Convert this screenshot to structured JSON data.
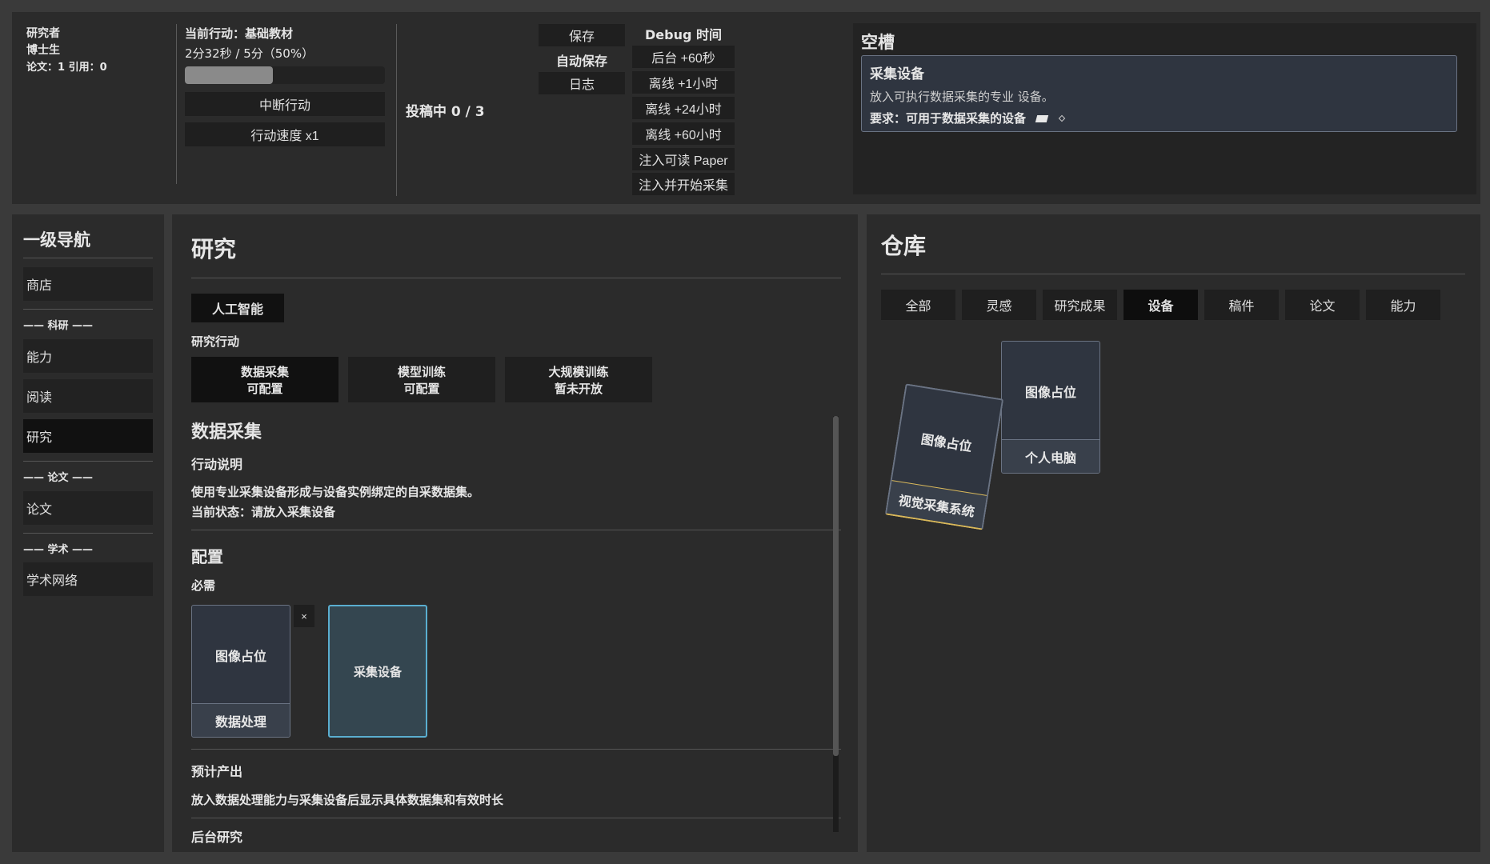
{
  "player": {
    "role": "研究者",
    "degree": "博士生",
    "stats": "论文：1  引用：0"
  },
  "action": {
    "current": "当前行动：基础教材",
    "time": "2分32秒 / 5分（50%）",
    "progress": 0.5,
    "interrupt": "中断行动",
    "speed": "行动速度 x1"
  },
  "submission": {
    "text": "投稿中 0 / 3"
  },
  "file_menu": {
    "save": "保存",
    "autosave": "自动保存",
    "log": "日志"
  },
  "debug": {
    "title": "Debug 时间",
    "buttons": [
      "后台 +60秒",
      "离线 +1小时",
      "离线 +24小时",
      "离线 +60小时",
      "注入可读 Paper",
      "注入并开始采集"
    ]
  },
  "slot": {
    "header": "空槽",
    "name": "采集设备",
    "desc": "放入可执行数据采集的专业 设备。",
    "req": "要求：可用于数据采集的设备"
  },
  "nav": {
    "title": "一级导航",
    "shop": "商店",
    "sec_research": "—— 科研 ——",
    "ability": "能力",
    "reading": "阅读",
    "research": "研究",
    "sec_paper": "—— 论文 ——",
    "paper": "论文",
    "sec_academic": "—— 学术 ——",
    "network": "学术网络"
  },
  "research": {
    "title": "研究",
    "field": "人工智能",
    "actions_label": "研究行动",
    "actions": [
      {
        "name": "数据采集",
        "state": "可配置"
      },
      {
        "name": "模型训练",
        "state": "可配置"
      },
      {
        "name": "大规模训练",
        "state": "暂未开放"
      }
    ],
    "section_title": "数据采集",
    "desc_label": "行动说明",
    "desc": "使用专业采集设备形成与设备实例绑定的自采数据集。",
    "status": "当前状态：请放入采集设备",
    "config_title": "配置",
    "required_label": "必需",
    "card1_img": "图像占位",
    "card1_label": "数据处理",
    "remove": "×",
    "slot_label": "采集设备",
    "output_label": "预计产出",
    "output_desc": "放入数据处理能力与采集设备后显示具体数据集和有效时长",
    "next_label": "后台研究"
  },
  "warehouse": {
    "title": "仓库",
    "tabs": [
      "全部",
      "灵感",
      "研究成果",
      "设备",
      "稿件",
      "论文",
      "能力"
    ],
    "active_tab": 3,
    "cardA_img": "图像占位",
    "cardA_label": "个人电脑",
    "cardB_img": "图像占位",
    "cardB_label": "视觉采集系统"
  },
  "colors": {
    "accent_slot": "#5aaed0",
    "gold": "#d9b85a",
    "panel": "#2b2b2b",
    "button": "#1f1f1f"
  }
}
